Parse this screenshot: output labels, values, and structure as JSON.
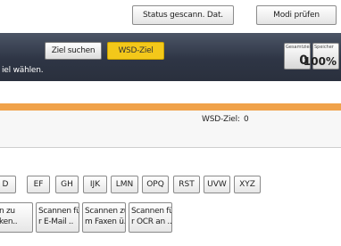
{
  "topbar": {
    "status_button": "Status gescann. Dat.",
    "mode_button": "Modi prüfen"
  },
  "header": {
    "search_button": "Ziel suchen",
    "wsd_button": "WSD-Ziel",
    "hint": "iel wählen.",
    "total_label": "Gesamtziel",
    "total_value": "0",
    "memory_label": "Speicher",
    "memory_value": "100%"
  },
  "panel": {
    "wsd_label": "WSD-Ziel:",
    "wsd_count": "0"
  },
  "letters": [
    "D",
    "EF",
    "GH",
    "IJK",
    "LMN",
    "OPQ",
    "RST",
    "UVW",
    "XYZ"
  ],
  "destinations": [
    {
      "line1": "n zu",
      "line2": "ken.."
    },
    {
      "line1": "Scannen fü",
      "line2": "r E-Mail .."
    },
    {
      "line1": "Scannen zu",
      "line2": "m Faxen ü.."
    },
    {
      "line1": "Scannen fü",
      "line2": "r OCR an .."
    }
  ],
  "colors": {
    "header_dark": "#2e3545",
    "accent_yellow": "#f3c81a",
    "accent_orange": "#f0a24a"
  }
}
